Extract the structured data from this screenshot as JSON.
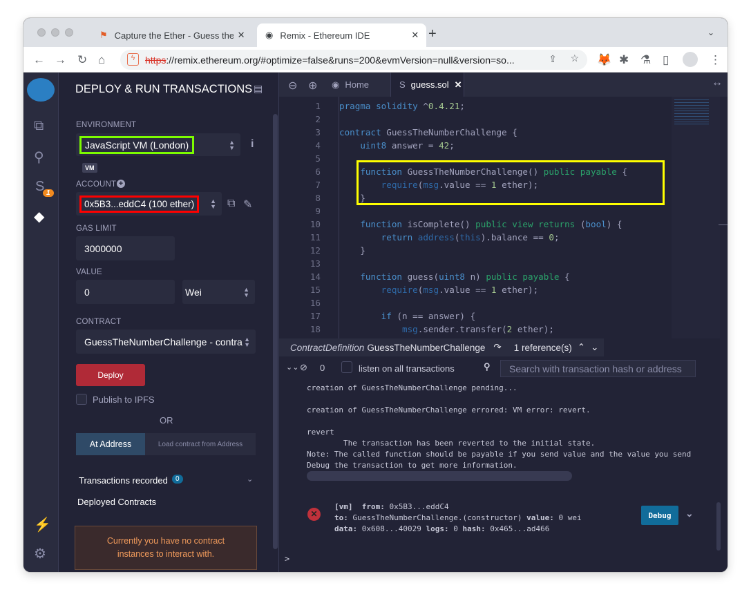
{
  "browser": {
    "tabs": [
      {
        "title": "Capture the Ether - Guess the r"
      },
      {
        "title": "Remix - Ethereum IDE"
      }
    ],
    "url_scheme": "https",
    "url_rest": "://remix.ethereum.org/#optimize=false&runs=200&evmVersion=null&version=so..."
  },
  "sidebar": {
    "title": "DEPLOY & RUN TRANSACTIONS",
    "environment_label": "ENVIRONMENT",
    "environment_value": "JavaScript VM (London)",
    "vm_badge": "VM",
    "account_label": "ACCOUNT",
    "account_value": "0x5B3...eddC4 (100 ether)",
    "plugin_badge": "1",
    "gas_limit_label": "GAS LIMIT",
    "gas_limit_value": "3000000",
    "value_label": "VALUE",
    "value_value": "0",
    "value_unit": "Wei",
    "contract_label": "CONTRACT",
    "contract_value": "GuessTheNumberChallenge - contra",
    "deploy_label": "Deploy",
    "publish_label": "Publish to IPFS",
    "or_label": "OR",
    "at_address_label": "At Address",
    "at_address_placeholder": "Load contract from Address",
    "transactions_recorded_label": "Transactions recorded",
    "transactions_recorded_count": "0",
    "deployed_contracts_label": "Deployed Contracts",
    "no_instances_msg": "Currently you have no contract instances to interact with."
  },
  "editor": {
    "tabs": [
      {
        "label": "Home"
      },
      {
        "label": "guess.sol"
      }
    ],
    "lines": [
      [
        [
          "pragma solidity ",
          "kw"
        ],
        [
          "^",
          "txt"
        ],
        [
          "0.4.21",
          "num"
        ],
        [
          ";",
          "txt"
        ]
      ],
      [],
      [
        [
          "contract ",
          "kw"
        ],
        [
          "GuessTheNumberChallenge {",
          "txt"
        ]
      ],
      [
        [
          "    ",
          "txt"
        ],
        [
          "uint8 ",
          "kw"
        ],
        [
          "answer = ",
          "txt"
        ],
        [
          "42",
          "num"
        ],
        [
          ";",
          "txt"
        ]
      ],
      [],
      [
        [
          "    ",
          "txt"
        ],
        [
          "function ",
          "kw"
        ],
        [
          "GuessTheNumberChallenge() ",
          "txt"
        ],
        [
          "public payable ",
          "vis"
        ],
        [
          "{",
          "txt"
        ]
      ],
      [
        [
          "        ",
          "txt"
        ],
        [
          "require",
          "glob"
        ],
        [
          "(",
          "txt"
        ],
        [
          "msg",
          "glob"
        ],
        [
          ".value == ",
          "txt"
        ],
        [
          "1",
          "num"
        ],
        [
          " ether);",
          "txt"
        ]
      ],
      [
        [
          "    }",
          "txt"
        ]
      ],
      [],
      [
        [
          "    ",
          "txt"
        ],
        [
          "function ",
          "kw"
        ],
        [
          "isComplete() ",
          "txt"
        ],
        [
          "public view returns ",
          "vis"
        ],
        [
          "(",
          "txt"
        ],
        [
          "bool",
          "kw"
        ],
        [
          ") {",
          "txt"
        ]
      ],
      [
        [
          "        ",
          "txt"
        ],
        [
          "return ",
          "kw"
        ],
        [
          "address",
          "glob"
        ],
        [
          "(",
          "txt"
        ],
        [
          "this",
          "glob"
        ],
        [
          ").balance == ",
          "txt"
        ],
        [
          "0",
          "num"
        ],
        [
          ";",
          "txt"
        ]
      ],
      [
        [
          "    }",
          "txt"
        ]
      ],
      [],
      [
        [
          "    ",
          "txt"
        ],
        [
          "function ",
          "kw"
        ],
        [
          "guess(",
          "txt"
        ],
        [
          "uint8 ",
          "kw"
        ],
        [
          "n) ",
          "txt"
        ],
        [
          "public payable ",
          "vis"
        ],
        [
          "{",
          "txt"
        ]
      ],
      [
        [
          "        ",
          "txt"
        ],
        [
          "require",
          "glob"
        ],
        [
          "(",
          "txt"
        ],
        [
          "msg",
          "glob"
        ],
        [
          ".value == ",
          "txt"
        ],
        [
          "1",
          "num"
        ],
        [
          " ether);",
          "txt"
        ]
      ],
      [],
      [
        [
          "        ",
          "txt"
        ],
        [
          "if ",
          "kw"
        ],
        [
          "(n == answer) {",
          "txt"
        ]
      ],
      [
        [
          "            ",
          "txt"
        ],
        [
          "msg",
          "glob"
        ],
        [
          ".sender.transfer(",
          "txt"
        ],
        [
          "2",
          "num"
        ],
        [
          " ether);",
          "txt"
        ]
      ],
      [
        [
          "        }",
          "txt"
        ]
      ]
    ],
    "reference_bar": {
      "kind": "ContractDefinition",
      "name": "GuessTheNumberChallenge",
      "refs": "1 reference(s)"
    }
  },
  "terminal": {
    "pending_count": "0",
    "listen_label": "listen on all transactions",
    "search_placeholder": "Search with transaction hash or address",
    "log": [
      "creation of GuessTheNumberChallenge pending...",
      "creation of GuessTheNumberChallenge errored: VM error: revert.",
      "revert",
      "\tThe transaction has been reverted to the initial state.",
      "Note: The called function should be payable if you send value and the value you send sh",
      "Debug the transaction to get more information."
    ],
    "tx": {
      "vm": "[vm]",
      "from_label": "from:",
      "from": "0x5B3...eddC4",
      "to_label": "to:",
      "to": "GuessTheNumberChallenge.(constructor)",
      "value_label": "value:",
      "value": "0 wei",
      "data_label": "data:",
      "data": "0x608...40029",
      "logs_label": "logs:",
      "logs": "0",
      "hash_label": "hash:",
      "hash": "0x465...ad466"
    },
    "debug_label": "Debug",
    "prompt": ">"
  },
  "colors": {
    "highlight_env": "#7cfc00",
    "highlight_account": "#ff0000",
    "highlight_code": "#ffff00",
    "deploy": "#b02a37",
    "debug": "#116c9a"
  }
}
